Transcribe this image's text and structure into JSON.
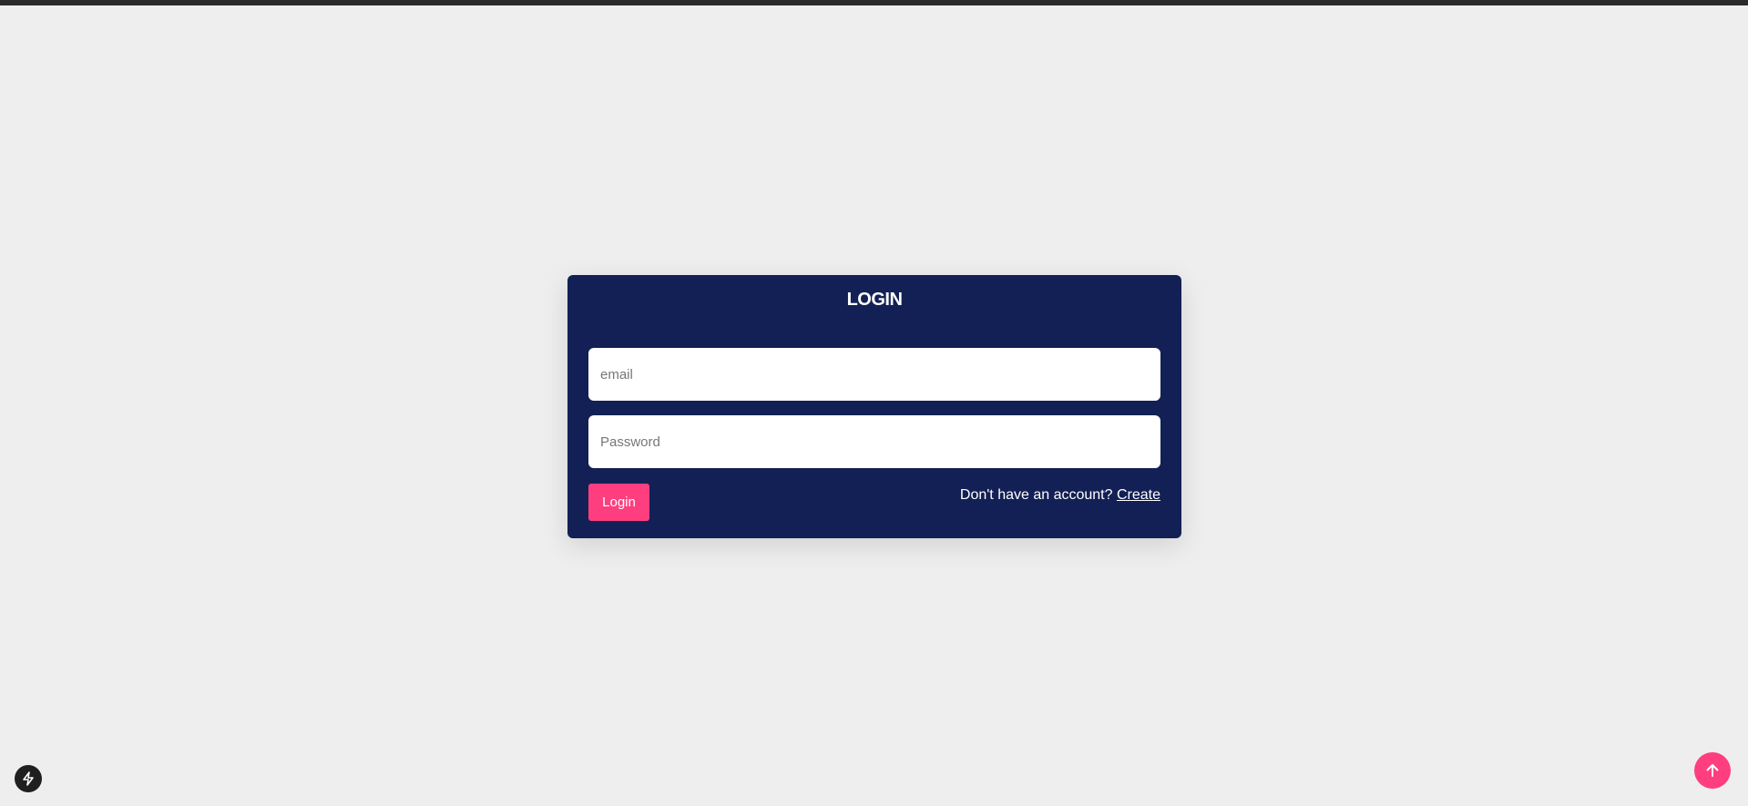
{
  "login": {
    "title": "LOGIN",
    "email_placeholder": "email",
    "password_placeholder": "Password",
    "button_label": "Login",
    "account_prompt": "Don't have an account?",
    "create_link": "Create"
  },
  "colors": {
    "background": "#eeeeee",
    "card": "#132055",
    "accent": "#ff3e7f",
    "top_bar": "#2a2a2a"
  },
  "icons": {
    "corner_badge": "lightning-bolt-icon",
    "scroll_top": "arrow-up-icon"
  }
}
